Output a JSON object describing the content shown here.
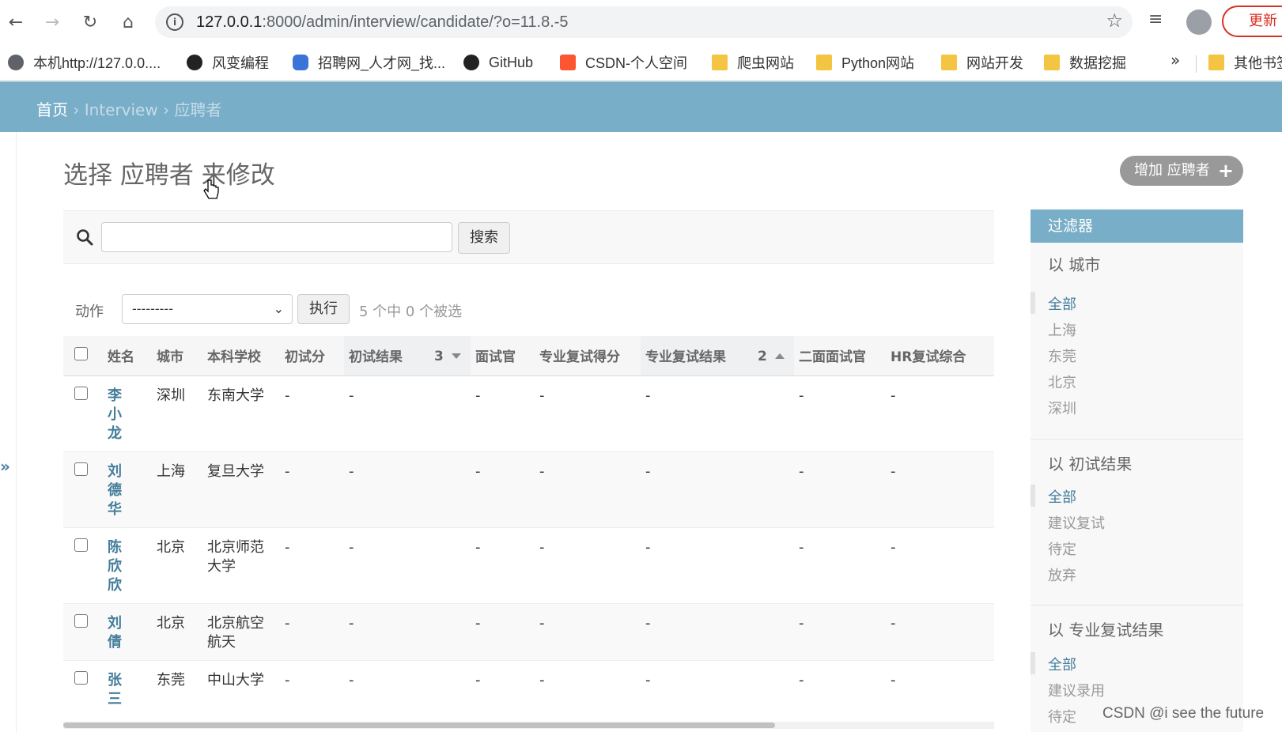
{
  "browser": {
    "url_host": "127.0.0.1",
    "url_path": ":8000/admin/interview/candidate/?o=11.8.-5",
    "update_label": "更新",
    "bookmarks": [
      {
        "label": "本机http://127.0.0....",
        "icon": "globe-icon"
      },
      {
        "label": "风变编程",
        "icon": "panda-icon"
      },
      {
        "label": "招聘网_人才网_找...",
        "icon": "hand-icon"
      },
      {
        "label": "GitHub",
        "icon": "github-icon"
      },
      {
        "label": "CSDN-个人空间",
        "icon": "csdn-icon"
      },
      {
        "label": "爬虫网站",
        "icon": "folder-icon"
      },
      {
        "label": "Python网站",
        "icon": "folder-icon"
      },
      {
        "label": "网站开发",
        "icon": "folder-icon"
      },
      {
        "label": "数据挖掘",
        "icon": "folder-icon"
      }
    ],
    "more_label": "»",
    "other_bookmarks": "其他书签"
  },
  "breadcrumbs": {
    "home": "首页",
    "sep": "›",
    "app": "Interview",
    "model": "应聘者"
  },
  "page_title": "选择 应聘者 来修改",
  "add_button": "增加 应聘者",
  "search": {
    "button": "搜索",
    "value": ""
  },
  "actions": {
    "label": "动作",
    "selected": "---------",
    "go": "执行",
    "counter": "5 个中 0 个被选"
  },
  "table": {
    "columns": [
      "姓名",
      "城市",
      "本科学校",
      "初试分",
      "初试结果",
      "面试官",
      "专业复试得分",
      "专业复试结果",
      "二面面试官",
      "HR复试综合"
    ],
    "sort_numbers": {
      "first_result": "3",
      "pro_result": "2"
    },
    "rows": [
      {
        "name": "李小龙",
        "city": "深圳",
        "school": "东南大学",
        "score": "-",
        "result": "-",
        "interviewer": "-",
        "pro_score": "-",
        "pro_result": "-",
        "second": "-",
        "hr": "-"
      },
      {
        "name": "刘德华",
        "city": "上海",
        "school": "复旦大学",
        "score": "-",
        "result": "-",
        "interviewer": "-",
        "pro_score": "-",
        "pro_result": "-",
        "second": "-",
        "hr": "-"
      },
      {
        "name": "陈欣欣",
        "city": "北京",
        "school": "北京师范大学",
        "score": "-",
        "result": "-",
        "interviewer": "-",
        "pro_score": "-",
        "pro_result": "-",
        "second": "-",
        "hr": "-"
      },
      {
        "name": "刘倩",
        "city": "北京",
        "school": "北京航空航天",
        "score": "-",
        "result": "-",
        "interviewer": "-",
        "pro_score": "-",
        "pro_result": "-",
        "second": "-",
        "hr": "-"
      },
      {
        "name": "张三",
        "city": "东莞",
        "school": "中山大学",
        "score": "-",
        "result": "-",
        "interviewer": "-",
        "pro_score": "-",
        "pro_result": "-",
        "second": "-",
        "hr": "-"
      }
    ]
  },
  "filter": {
    "title": "过滤器",
    "groups": [
      {
        "title": "以 城市",
        "items": [
          "全部",
          "上海",
          "东莞",
          "北京",
          "深圳"
        ]
      },
      {
        "title": "以 初试结果",
        "items": [
          "全部",
          "建议复试",
          "待定",
          "放弃"
        ]
      },
      {
        "title": "以 专业复试结果",
        "items": [
          "全部",
          "建议录用",
          "待定"
        ]
      }
    ]
  },
  "watermark": "CSDN @i see the future",
  "colors": {
    "header": "#79aec8",
    "link": "#447e9b",
    "update": "#d93025"
  }
}
